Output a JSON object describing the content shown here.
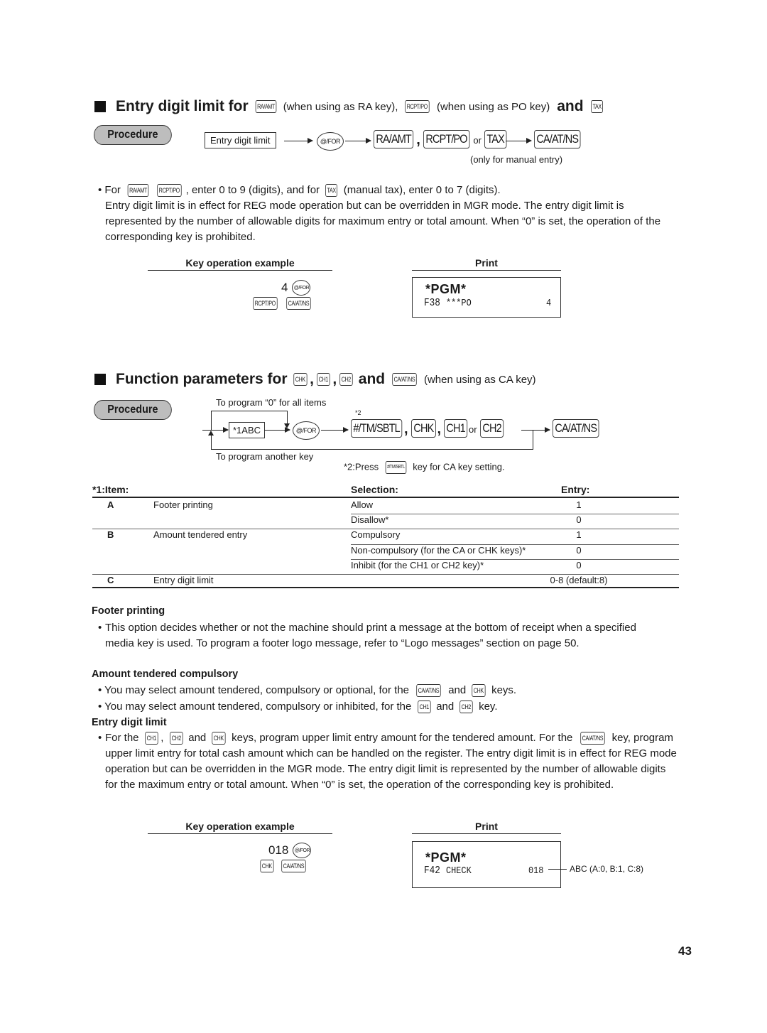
{
  "page_number": "43",
  "section1": {
    "heading_parts": [
      "Entry digit limit for",
      "(when using as RA key),",
      "(when using as PO key)",
      "and"
    ],
    "heading_keys": [
      "RA/AMT",
      "RCPT/PO",
      "TAX"
    ],
    "procedure_label": "Procedure",
    "flow": {
      "box": "Entry digit limit",
      "for_key": "@/FOR",
      "key1": "RA/AMT",
      "key2": "RCPT/PO",
      "or": "or",
      "key3": "TAX",
      "final_key": "CA/AT/NS",
      "note": "(only for manual entry)"
    },
    "bullet": {
      "prefix": "For",
      "keys": [
        "RA/AMT",
        "RCPT/PO",
        "TAX"
      ],
      "mid": ", enter 0 to 9 (digits), and for",
      "suffix": "(manual tax), enter 0 to 7 (digits).",
      "paragraph": "Entry digit limit is in effect for REG mode operation but can be overridden in MGR mode.  The entry digit limit is represented by the number of allowable digits for maximum entry or total amount.  When “0” is set, the operation of the corresponding key is prohibited."
    },
    "example": {
      "key_op_title": "Key operation example",
      "print_title": "Print",
      "entry_value": "4",
      "for_key": "@/FOR",
      "keys": [
        "RCPT/PO",
        "CA/AT/NS"
      ],
      "print_header": "*PGM*",
      "print_line_code": "F38",
      "print_line_label": "***PO",
      "print_line_value": "4"
    }
  },
  "section2": {
    "heading_parts": [
      "Function parameters for",
      ",",
      ",",
      "and",
      "(when using as CA key)"
    ],
    "heading_keys": [
      "CHK",
      "CH1",
      "CH2",
      "CA/AT/NS"
    ],
    "procedure_label": "Procedure",
    "flow": {
      "loop_top": "To program  “0” for all items",
      "loop_bottom": "To program another key",
      "box": "*1ABC",
      "for_key": "@/FOR",
      "star2": "*2",
      "keys": [
        "#/TM/SBTL",
        "CHK",
        "CH1",
        "CH2"
      ],
      "or": "or",
      "final_key": "CA/AT/NS",
      "note_prefix": "*2:Press",
      "note_key": "#/TM/SBTL",
      "note_suffix": "key for CA key setting."
    },
    "table": {
      "headers": {
        "item": "*1:Item:",
        "selection": "Selection:",
        "entry": "Entry:"
      },
      "rows": [
        {
          "code": "A",
          "item": "Footer printing",
          "selection": "Allow",
          "entry": "1"
        },
        {
          "code": "",
          "item": "",
          "selection": "Disallow*",
          "entry": "0"
        },
        {
          "code": "B",
          "item": "Amount tendered entry",
          "selection": "Compulsory",
          "entry": "1"
        },
        {
          "code": "",
          "item": "",
          "selection": "Non-compulsory (for the CA or CHK keys)*",
          "entry": "0"
        },
        {
          "code": "",
          "item": "",
          "selection": "Inhibit (for the CH1 or CH2 key)*",
          "entry": "0"
        },
        {
          "code": "C",
          "item": "Entry digit limit",
          "selection": "",
          "entry": "0-8 (default:8)"
        }
      ]
    },
    "footer_printing": {
      "title": "Footer printing",
      "text": "This option decides whether or not the machine should print a message at the bottom of receipt when a specified media key is used.  To program a footer logo message, refer to “Logo messages” section on page 50."
    },
    "amount_tendered": {
      "title": "Amount tendered compulsory",
      "b1_prefix": "You may select amount tendered, compulsory or optional, for the",
      "b1_key1": "CA/AT/NS",
      "b1_and": "and",
      "b1_key2": "CHK",
      "b1_suffix": "keys.",
      "b2_prefix": "You may select amount tendered, compulsory or inhibited, for the",
      "b2_key1": "CH1",
      "b2_and": "and",
      "b2_key2": "CH2",
      "b2_suffix": "key."
    },
    "entry_digit": {
      "title": "Entry digit limit",
      "prefix": "For the",
      "key1": "CH1",
      "key2": "CH2",
      "and": "and",
      "key3": "CHK",
      "mid": "keys, program upper limit entry amount for the tendered amount.  For the",
      "key4": "CA/AT/NS",
      "rest": "key, program upper limit entry for total cash amount which can be handled on the register.  The entry digit limit is in effect for REG mode operation but can be overridden in the MGR mode.  The entry digit limit is represented by the number of allowable digits for the maximum entry or total amount.  When “0” is set, the operation of the corresponding key is prohibited."
    },
    "example": {
      "key_op_title": "Key operation example",
      "print_title": "Print",
      "entry_value": "018",
      "for_key": "@/FOR",
      "keys": [
        "CHK",
        "CA/AT/NS"
      ],
      "print_header": "*PGM*",
      "print_line_code": "F42",
      "print_line_label": "CHECK",
      "print_line_value": "018",
      "annotation": "ABC (A:0, B:1, C:8)"
    }
  }
}
